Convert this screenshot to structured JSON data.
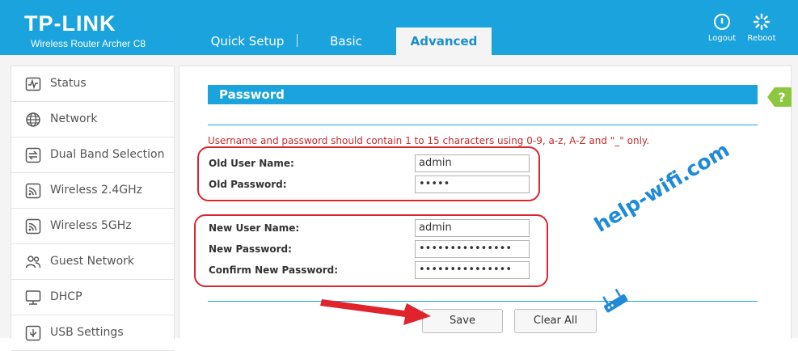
{
  "brand": {
    "logo": "TP-LINK",
    "model": "Wireless Router Archer C8"
  },
  "tabs": [
    {
      "label": "Quick Setup",
      "active": false
    },
    {
      "label": "Basic",
      "active": false
    },
    {
      "label": "Advanced",
      "active": true
    }
  ],
  "header_actions": {
    "logout_label": "Logout",
    "reboot_label": "Reboot"
  },
  "sidebar": {
    "items": [
      {
        "label": "Status",
        "icon": "status-icon"
      },
      {
        "label": "Network",
        "icon": "globe-icon"
      },
      {
        "label": "Dual Band Selection",
        "icon": "dual-band-icon"
      },
      {
        "label": "Wireless 2.4GHz",
        "icon": "wireless-icon"
      },
      {
        "label": "Wireless 5GHz",
        "icon": "wireless-icon"
      },
      {
        "label": "Guest Network",
        "icon": "guest-icon"
      },
      {
        "label": "DHCP",
        "icon": "monitor-icon"
      },
      {
        "label": "USB Settings",
        "icon": "usb-icon"
      }
    ]
  },
  "section": {
    "title": "Password",
    "help_label": "?",
    "note": "Username and password should contain 1 to 15 characters using 0-9, a-z, A-Z and \"_\" only."
  },
  "form": {
    "old_user_name_label": "Old User Name:",
    "old_user_name_value": "admin",
    "old_password_label": "Old Password:",
    "old_password_value": "•••••",
    "new_user_name_label": "New User Name:",
    "new_user_name_value": "admin",
    "new_password_label": "New Password:",
    "new_password_value": "•••••••••••••••",
    "confirm_password_label": "Confirm New Password:",
    "confirm_password_value": "•••••••••••••••"
  },
  "buttons": {
    "save_label": "Save",
    "clear_label": "Clear All"
  },
  "watermark": "help-wifi.com",
  "colors": {
    "header": "#1aa3dc",
    "accent": "#1aa3dc",
    "annotation": "#d9262f",
    "note": "#c52b2b",
    "help": "#8dc63f",
    "watermark": "#1f8ad6"
  }
}
